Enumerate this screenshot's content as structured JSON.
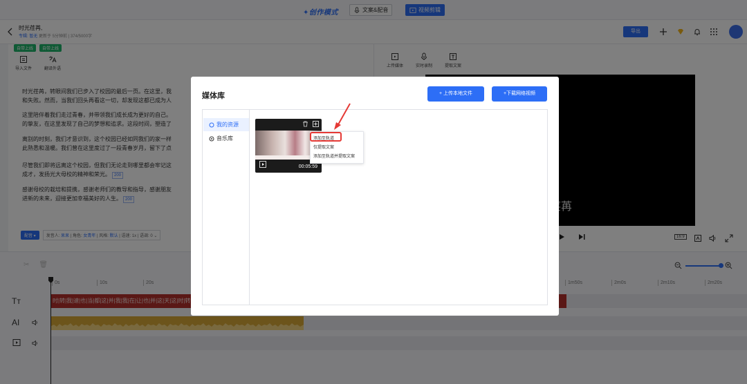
{
  "topbar": {
    "mode_label": "✦创作模式",
    "btn_copy_voice": "文案&配音",
    "btn_video_edit": "视频剪辑"
  },
  "header": {
    "title": "时光荏苒,",
    "meta_prefix": "专辑:",
    "meta_album": "暂无",
    "meta_rest": "更新于 5分钟前 | 374/5000字",
    "export_label": "导出"
  },
  "editor": {
    "tags": [
      "自带上线",
      "自带上线"
    ],
    "tools": [
      {
        "label": "导入文件",
        "icon": "import-icon"
      },
      {
        "label": "翻译外语",
        "icon": "translate-icon"
      }
    ],
    "paragraphs": [
      {
        "text": "时光荏苒，转眼间我们已步入了校园的最后一页。在这里，我",
        "line2": "和失败。然而，当我们回头再看这一切，却发现这都已成为人"
      },
      {
        "text": "这里陪伴着我们走过青春，并带领我们成长成为更好的自己。",
        "line2": "的挚友，在这里发现了自己的梦想和追求。这段时间，塑造了"
      },
      {
        "text": "离别的时刻，我们才意识到，这个校园已经如同我们的家一样",
        "line2": "此熟悉和温暖。我们曾在这里度过了一段青春岁月，留下了点"
      },
      {
        "text": "尽管我们即将远离这个校园，但我们无论走到哪里都会牢记这",
        "line2": "成才，发扬光大母校的精神和荣光。",
        "dur": "200"
      },
      {
        "text": "感谢母校的栽培和提携，感谢老师们的教导和指导，感谢朋友",
        "line2": "进新的未来，迎接更加幸福美好的人生。",
        "dur": "200"
      }
    ],
    "voice_btn": "配音",
    "voice_info": {
      "speaker_label": "发音人:",
      "speaker": "呆呆",
      "role_label": "| 角色:",
      "role": "女青年",
      "style_label": "| 风格:",
      "style": "默认",
      "rest": "| 语速: 1x | 语调: 0"
    }
  },
  "preview": {
    "tools": [
      {
        "label": "上传媒体",
        "icon": "upload-media-icon"
      },
      {
        "label": "实时录制",
        "icon": "microphone-icon"
      },
      {
        "label": "提取文案",
        "icon": "text-extract-icon"
      }
    ],
    "subtitle": "荏苒",
    "ratio": "16:9"
  },
  "timeline": {
    "ruler": [
      "0s",
      "10s",
      "20s",
      "1m50s",
      "2m0s",
      "2m10s",
      "2m20s"
    ],
    "track_labels": [
      "Tт",
      "AI"
    ],
    "subtitle_clip_text": "时|转|我|速|也|当|都|这|并|我|我|在|让|也|并|这|天|这|时|转|我|速|也|当|都|这|并|我|我|在|让|也|并|这|天|这|时|转|我|速|也|当|都|这"
  },
  "modal": {
    "title": "媒体库",
    "upload_local": "+ 上传本地文件",
    "download_net": "+下载网络视频",
    "sidebar": [
      {
        "label": "我的资源",
        "active": true
      },
      {
        "label": "音乐库",
        "active": false
      }
    ],
    "card": {
      "duration": "00:05:59"
    },
    "context_menu": [
      "添加至轨道",
      "仅提取文案",
      "添加至轨道并提取文案"
    ]
  },
  "colors": {
    "accent": "#2d6ef6",
    "tag_green": "#1fb56b",
    "subtitle_track": "#b5302d",
    "audio_track": "#d8a836",
    "highlight_red": "#e53935"
  }
}
